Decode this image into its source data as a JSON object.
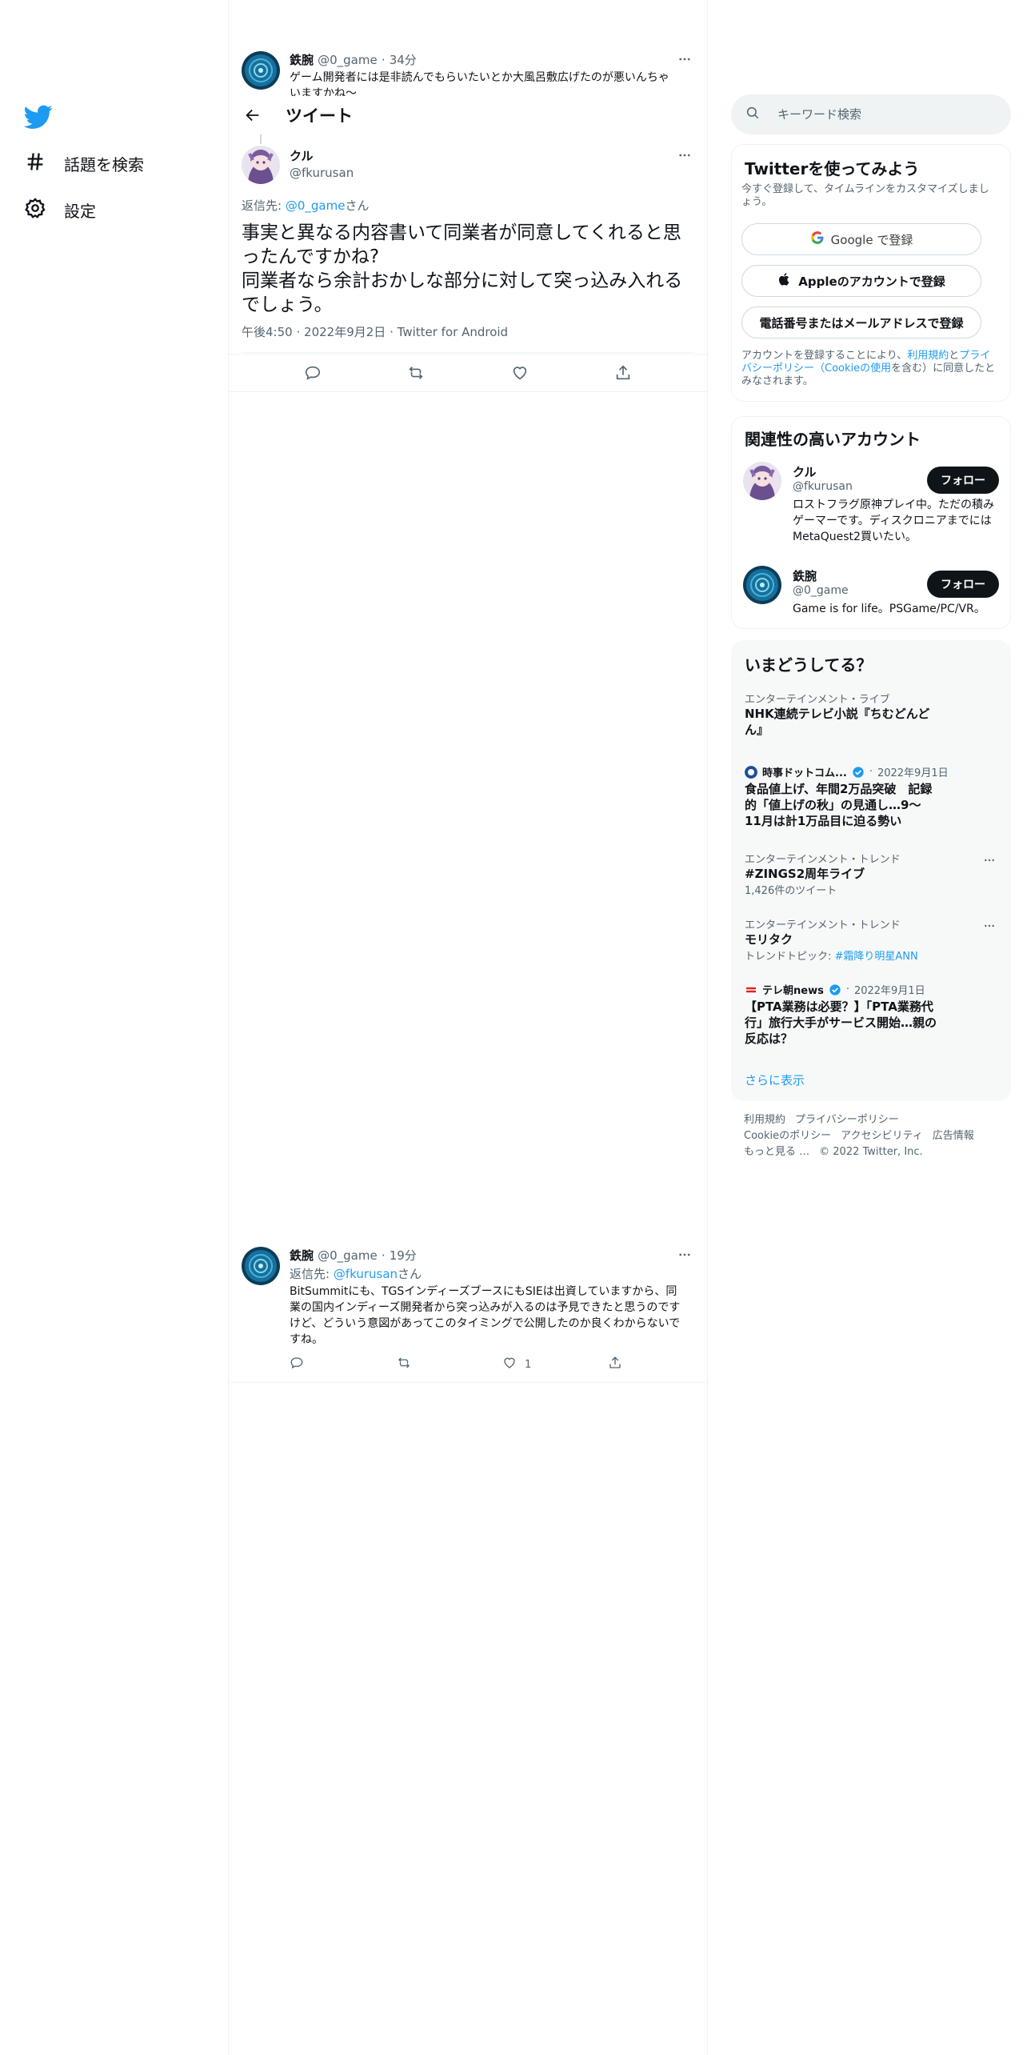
{
  "nav": {
    "explore_label": "話題を検索",
    "settings_label": "設定"
  },
  "parent_tweet": {
    "name": "鉄腕",
    "handle": "@0_game",
    "time": "34分",
    "text": "ゲーム開発者には是非読んでもらいたいとか大風呂敷広げたのが悪いんちゃいますかね～"
  },
  "header": {
    "title": "ツイート"
  },
  "main_tweet": {
    "name": "クル",
    "handle": "@fkurusan",
    "reply_prefix": "返信先: ",
    "reply_to": "@0_game",
    "reply_suffix": "さん",
    "text_line1": "事実と異なる内容書いて同業者が同意してくれると思ったんですかね?",
    "text_line2": "同業者なら余計おかしな部分に対して突っ込み入れるでしょう。",
    "time": "午後4:50",
    "date": "2022年9月2日",
    "client": "Twitter for Android"
  },
  "reply_tweet": {
    "name": "鉄腕",
    "handle": "@0_game",
    "time": "19分",
    "reply_prefix": "返信先: ",
    "reply_to": "@fkurusan",
    "reply_suffix": "さん",
    "text": "BitSummitにも、TGSインディーズブースにもSIEは出資していますから、同業の国内インディーズ開発者から突っ込みが入るのは予見できたと思うのですけど、どういう意図があってこのタイミングで公開したのか良くわからないですね。",
    "like_count": "1"
  },
  "search": {
    "placeholder": "キーワード検索"
  },
  "signup": {
    "title": "Twitterを使ってみよう",
    "subtitle": "今すぐ登録して、タイムラインをカスタマイズしましょう。",
    "google_label": "Google で登録",
    "apple_label": "Appleのアカウントで登録",
    "phone_label": "電話番号またはメールアドレスで登録",
    "terms_1": "アカウントを登録することにより、",
    "terms_link1": "利用規約",
    "terms_2": "と",
    "terms_link2": "プライバシーポリシー（Cookieの使用",
    "terms_3": "を含む）に同意したとみなされます。"
  },
  "related": {
    "title": "関連性の高いアカウント",
    "follow_label": "フォロー",
    "accounts": [
      {
        "name": "クル",
        "handle": "@fkurusan",
        "bio": "ロストフラグ原神プレイ中。ただの積みゲーマーです。ディスクロニアまでにはMetaQuest2買いたい。"
      },
      {
        "name": "鉄腕",
        "handle": "@0_game",
        "bio": "Game is for life。PSGame/PC/VR。"
      }
    ]
  },
  "trends": {
    "title": "いまどうしてる？",
    "items": [
      {
        "category": "エンターテインメント・ライブ",
        "title": "NHK連続テレビ小説『ちむどんどん』"
      },
      {
        "source": "時事ドットコム...",
        "date": "2022年9月1日",
        "title": "食品値上げ、年間2万品突破　記録的「値上げの秋」の見通し…9～11月は計1万品目に迫る勢い"
      },
      {
        "category": "エンターテインメント・トレンド",
        "title": "#ZINGS2周年ライブ",
        "sub": "1,426件のツイート"
      },
      {
        "category": "エンターテインメント・トレンド",
        "title": "モリタク",
        "sub_prefix": "トレンドトピック: ",
        "sub_link": "#霜降り明星ANN"
      },
      {
        "source": "テレ朝news",
        "date": "2022年9月1日",
        "title": "【PTA業務は必要？】「PTA業務代行」旅行大手がサービス開始…親の反応は？"
      }
    ],
    "show_more": "さらに表示"
  },
  "footer": {
    "terms": "利用規約",
    "privacy": "プライバシーポリシー",
    "cookie": "Cookieのポリシー",
    "accessibility": "アクセシビリティ",
    "ads": "広告情報",
    "more": "もっと見る …",
    "copyright": "© 2022 Twitter, Inc."
  },
  "colors": {
    "accent": "#1d9bf0",
    "text": "#0f1419",
    "secondary": "#536471",
    "border": "#eff3f4"
  }
}
